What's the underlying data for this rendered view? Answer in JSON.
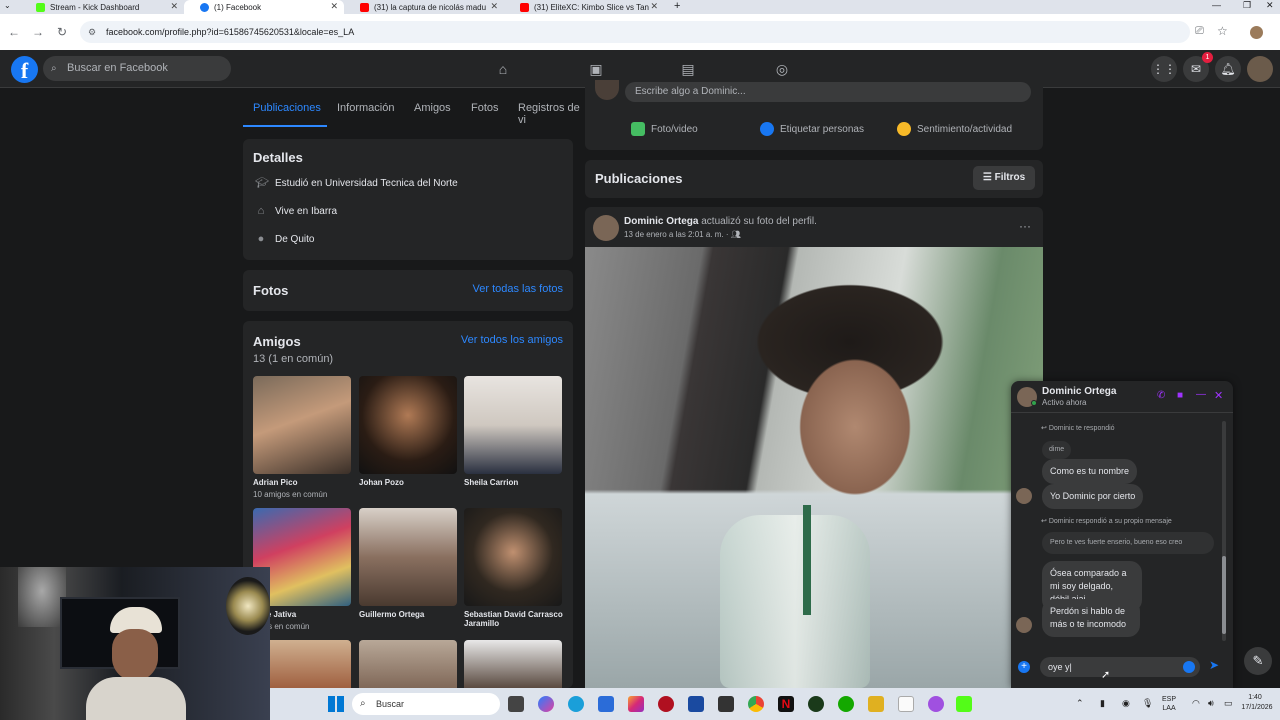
{
  "browser": {
    "tabs": [
      {
        "label": "Stream - Kick Dashboard",
        "favicon_color": "#53fc18"
      },
      {
        "label": "(1) Facebook",
        "favicon_color": "#1877f2"
      },
      {
        "label": "(31) la captura de nicolás madu",
        "favicon_color": "#ff0000"
      },
      {
        "label": "(31) EliteXC: Kimbo Slice vs Tan",
        "favicon_color": "#ff0000"
      }
    ],
    "new_tab": "+",
    "url": "facebook.com/profile.php?id=61586745620531&locale=es_LA"
  },
  "fb_header": {
    "logo": "f",
    "search_placeholder": "Buscar en Facebook",
    "messenger_badge": "1",
    "accent": "#1877f2"
  },
  "profile_tabs": [
    "Publicaciones",
    "Información",
    "Amigos",
    "Fotos",
    "Registros de vi"
  ],
  "details": {
    "title": "Detalles",
    "rows": [
      {
        "icon": "graduation-cap-icon",
        "text": "Estudió en Universidad Tecnica del Norte"
      },
      {
        "icon": "home-icon",
        "text": "Vive en Ibarra"
      },
      {
        "icon": "location-pin-icon",
        "text": "De Quito"
      }
    ]
  },
  "photos": {
    "title": "Fotos",
    "link": "Ver todas las fotos"
  },
  "friends": {
    "title": "Amigos",
    "count": "13 (1 en común)",
    "link": "Ver todos los amigos",
    "items": [
      {
        "name": "Adrian Pico",
        "mutual": "10 amigos en común"
      },
      {
        "name": "Johan Pozo",
        "mutual": ""
      },
      {
        "name": "Sheila Carrion",
        "mutual": ""
      },
      {
        "name": "nelle Jativa",
        "mutual": "nigos en común"
      },
      {
        "name": "Guillermo Ortega",
        "mutual": ""
      },
      {
        "name": "Sebastian David Carrasco Jaramillo",
        "mutual": ""
      }
    ]
  },
  "composer": {
    "placeholder": "Escribe algo a Dominic...",
    "actions": [
      "Foto/video",
      "Etiquetar personas",
      "Sentimiento/actividad"
    ]
  },
  "posts_header": {
    "title": "Publicaciones",
    "filters": "Filtros"
  },
  "post": {
    "author": "Dominic Ortega",
    "action": "actualizó su foto del perfil.",
    "date": "13 de enero a las 2:01 a. m. ·",
    "more": "···"
  },
  "chat": {
    "name": "Dominic Ortega",
    "status": "Activo ahora",
    "reply_note_1": "Dominic te respondió",
    "messages": [
      "dime",
      "Como es tu nombre",
      "Yo Dominic por cierto"
    ],
    "reply_note_2": "Dominic respondió a su propio mensaje",
    "quoted": "Pero te ves fuerte enserio, bueno eso creo",
    "messages_2": [
      "Ósea comparado a mi soy delgado, débil ajaj",
      "Perdón si hablo de más o te incomodo"
    ],
    "input_value": "oye y",
    "accent": "#a033ff"
  },
  "taskbar": {
    "search": "Buscar",
    "lang": "ESP\nLAA",
    "time": "1:40",
    "date": "17/1/2026"
  }
}
